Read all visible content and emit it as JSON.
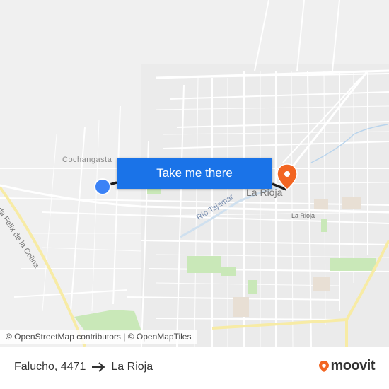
{
  "map": {
    "labels": {
      "cochangasta": "Cochangasta",
      "la_rioja_city": "La Rioja",
      "la_rioja_small": "La Rioja",
      "rio_tajamar": "Río Tajamar",
      "felix_colina": "ada Felix de la Colina"
    },
    "origin_marker": {
      "icon": "current-location-dot-icon",
      "color": "#3b82f6"
    },
    "destination_marker": {
      "icon": "destination-pin-icon",
      "color": "#f26522"
    },
    "route_color": "#1c1c1c",
    "green_area_color": "#c9e8b8",
    "road_color": "#ffffff",
    "main_road_color": "#f7eba5"
  },
  "cta": {
    "label": "Take me there"
  },
  "attribution": {
    "text": "© OpenStreetMap contributors | © OpenMapTiles"
  },
  "footer": {
    "origin": "Falucho, 4471",
    "destination": "La Rioja",
    "arrow_icon": "arrow-right-icon",
    "brand": "moovit",
    "brand_icon": "moovit-pin-icon",
    "brand_color": "#f26522"
  }
}
